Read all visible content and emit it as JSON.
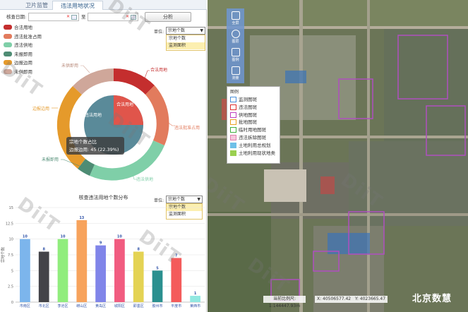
{
  "tabs": [
    "卫片监管",
    "违法用地状况"
  ],
  "filter": {
    "label": "核查日期:",
    "to": "至",
    "analyze": "分析"
  },
  "legend": [
    {
      "label": "合法用地",
      "color": "#c42e2e"
    },
    {
      "label": "违法批准占用",
      "color": "#e27b5d"
    },
    {
      "label": "违法供地",
      "color": "#7fcfa8"
    },
    {
      "label": "未报即用",
      "color": "#4e8c74"
    },
    {
      "label": "边报边用",
      "color": "#e59a2b"
    },
    {
      "label": "未供即用",
      "color": "#cfa79a"
    }
  ],
  "unit": {
    "label": "单位:",
    "selected": "宗地个数",
    "options": [
      "宗地个数",
      "监测面积"
    ]
  },
  "donut": {
    "inner_labels": [
      "违法用地",
      "合法用地"
    ],
    "outer_labels": [
      "合法用地",
      "违法批准占用",
      "违法供地",
      "未报即用",
      "边报边用",
      "未供即用"
    ],
    "tooltip_line1": "宗地个数占比",
    "tooltip_line2": "边报边用: 45 (22.39%)"
  },
  "bar_section": {
    "title": "核查违法用地个数分布",
    "unit_label": "单位:",
    "selected": "宗地个数",
    "options": [
      "宗地个数",
      "监测面积"
    ]
  },
  "chart_data": {
    "type": "bar",
    "title": "核查违法用地个数分布",
    "ylabel": "宗地个数",
    "ylim": [
      0,
      15
    ],
    "yticks": [
      0,
      2.5,
      5,
      7.5,
      10,
      12.5,
      15
    ],
    "categories": [
      "市南区",
      "市北区",
      "李沧区",
      "崂山区",
      "黄岛区",
      "城阳区",
      "即墨区",
      "胶州市",
      "平度市",
      "莱西市"
    ],
    "values": [
      10,
      8,
      10,
      13,
      9,
      10,
      8,
      5,
      7,
      1
    ],
    "colors": [
      "#7cb5ec",
      "#434348",
      "#90ed7d",
      "#f7a35c",
      "#8085e9",
      "#f15c80",
      "#e4d354",
      "#2b908f",
      "#f45b5b",
      "#91e8e1"
    ]
  },
  "map": {
    "toolbar": [
      "全屏",
      "图层",
      "图例",
      "测量"
    ],
    "legend_title": "图例",
    "legend_items": [
      {
        "label": "监测图斑",
        "color": "#4a90d9"
      },
      {
        "label": "违法图斑",
        "color": "#e03030"
      },
      {
        "label": "供地图斑",
        "color": "#c040c0"
      },
      {
        "label": "批地图斑",
        "color": "#e8a020"
      },
      {
        "label": "临时用地图斑",
        "color": "#40b040"
      },
      {
        "label": "违法拆除图斑",
        "color": "#e080b0"
      },
      {
        "label": "土地利用总规划",
        "color": "#6fc0e8"
      },
      {
        "label": "土地利用现状地类",
        "color": "#9ad050"
      }
    ],
    "scale": "当前比例尺: 1:144447.93m",
    "coord_x": "X: 40506577.42",
    "coord_y": "Y: 4023665.47",
    "brand": "北京数慧"
  },
  "watermark": "DiiT"
}
